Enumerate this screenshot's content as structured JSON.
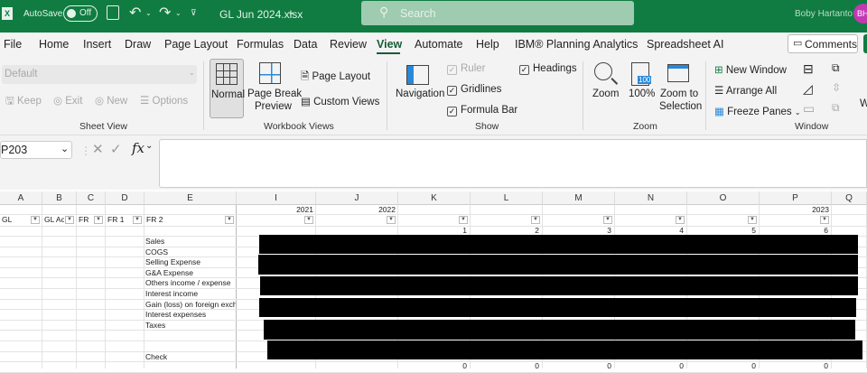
{
  "titlebar": {
    "autosave_label": "AutoSave",
    "autosave_state": "Off",
    "filename": "GL Jun 2024.xlsx",
    "search_placeholder": "Search",
    "user_name": "Boby Hartanto",
    "user_initials": "BH"
  },
  "tabs": [
    "File",
    "Home",
    "Insert",
    "Draw",
    "Page Layout",
    "Formulas",
    "Data",
    "Review",
    "View",
    "Automate",
    "Help",
    "IBM® Planning Analytics",
    "Spreadsheet AI"
  ],
  "active_tab": "View",
  "comments_label": "Comments",
  "ribbon": {
    "sheet_view": {
      "dropdown": "Default",
      "keep": "Keep",
      "exit": "Exit",
      "new": "New",
      "options": "Options",
      "group": "Sheet View"
    },
    "workbook_views": {
      "normal": "Normal",
      "page_break_1": "Page Break",
      "page_break_2": "Preview",
      "page_layout": "Page Layout",
      "custom_views": "Custom Views",
      "group": "Workbook Views"
    },
    "show": {
      "navigation": "Navigation",
      "ruler": "Ruler",
      "gridlines": "Gridlines",
      "formula_bar": "Formula Bar",
      "headings": "Headings",
      "group": "Show"
    },
    "zoom": {
      "zoom": "Zoom",
      "hundred": "100%",
      "icon_text": "100",
      "zoom_sel_1": "Zoom to",
      "zoom_sel_2": "Selection",
      "group": "Zoom"
    },
    "window": {
      "new_window": "New Window",
      "arrange_all": "Arrange All",
      "freeze_panes": "Freeze Panes",
      "group": "Window",
      "cut_label": "W"
    }
  },
  "formula_bar": {
    "name_box": "P203",
    "fx": "fx",
    "value": ""
  },
  "columns": [
    "A",
    "B",
    "C",
    "D",
    "E",
    "I",
    "J",
    "K",
    "L",
    "M",
    "N",
    "O",
    "P",
    "Q"
  ],
  "years": {
    "I": "2021",
    "J": "2022",
    "P": "2023"
  },
  "filters": [
    "GL",
    "GL Acc",
    "FR",
    "FR 1",
    "FR 2"
  ],
  "periods": [
    "1",
    "2",
    "3",
    "4",
    "5",
    "6"
  ],
  "row_labels": [
    "Sales",
    "COGS",
    "Selling Expense",
    "G&A Expense",
    "Others income / expense",
    "Interest income",
    "Gain (loss) on foreign excha",
    "Interest expenses",
    "Taxes",
    "",
    "",
    "Check"
  ],
  "check_values": [
    "0",
    "0",
    "0",
    "0",
    "0",
    "0"
  ]
}
